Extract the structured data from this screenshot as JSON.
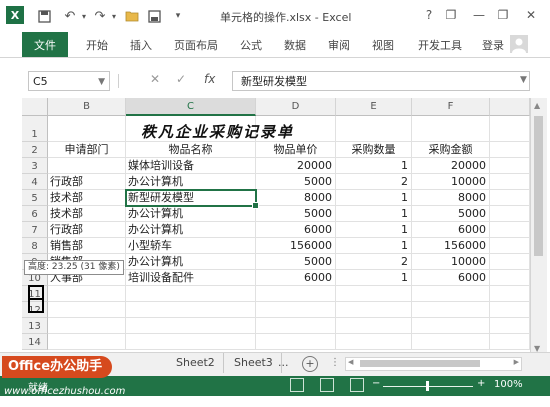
{
  "window": {
    "title": "单元格的操作.xlsx - Excel",
    "logo_text": "X",
    "help": "?",
    "minimize": "—",
    "restore": "❐",
    "close": "✕"
  },
  "quick_access": {
    "save_icon": "save-icon",
    "undo_icon": "undo-icon",
    "redo_icon": "redo-icon",
    "open_icon": "folder-open-icon",
    "save_as_icon": "save-as-icon"
  },
  "ribbon": {
    "file": "文件",
    "tabs": [
      "开始",
      "插入",
      "页面布局",
      "公式",
      "数据",
      "审阅",
      "视图",
      "开发工具"
    ],
    "login": "登录"
  },
  "formula_bar": {
    "name_box": "C5",
    "cancel": "✕",
    "enter": "✓",
    "fx": "fx",
    "value": "新型研发模型"
  },
  "columns": [
    "B",
    "C",
    "D",
    "E",
    "F"
  ],
  "selected_column": "C",
  "rows": [
    "1",
    "2",
    "3",
    "4",
    "5",
    "6",
    "7",
    "8",
    "9",
    "10",
    "11",
    "12",
    "13",
    "14"
  ],
  "sheet": {
    "title": "秩凡企业采购记录单",
    "headers": [
      "申请部门",
      "物品名称",
      "物品单价",
      "采购数量",
      "采购金额"
    ],
    "data": [
      [
        "",
        "媒体培训设备",
        "20000",
        "1",
        "20000"
      ],
      [
        "行政部",
        "办公计算机",
        "5000",
        "2",
        "10000"
      ],
      [
        "技术部",
        "新型研发模型",
        "8000",
        "1",
        "8000"
      ],
      [
        "技术部",
        "办公计算机",
        "5000",
        "1",
        "5000"
      ],
      [
        "行政部",
        "办公计算机",
        "6000",
        "1",
        "6000"
      ],
      [
        "销售部",
        "小型轿车",
        "156000",
        "1",
        "156000"
      ],
      [
        "销售部",
        "办公计算机",
        "5000",
        "2",
        "10000"
      ],
      [
        "人事部",
        "培训设备配件",
        "6000",
        "1",
        "6000"
      ]
    ]
  },
  "tooltip": "高度: 23.25 (31 像素)",
  "tabs_bottom": {
    "sheets": [
      "Sheet2",
      "Sheet3"
    ],
    "more": "...",
    "add": "+"
  },
  "status": {
    "mode": "就绪",
    "zoom_minus": "−",
    "zoom_plus": "+",
    "zoom": "100%",
    "zoom_level": 1.0
  },
  "watermark": {
    "brand": "Office办公助手",
    "url": "www.officezhushou.com"
  },
  "colors": {
    "excel_green": "#217346",
    "watermark_orange": "#d64a1e"
  }
}
